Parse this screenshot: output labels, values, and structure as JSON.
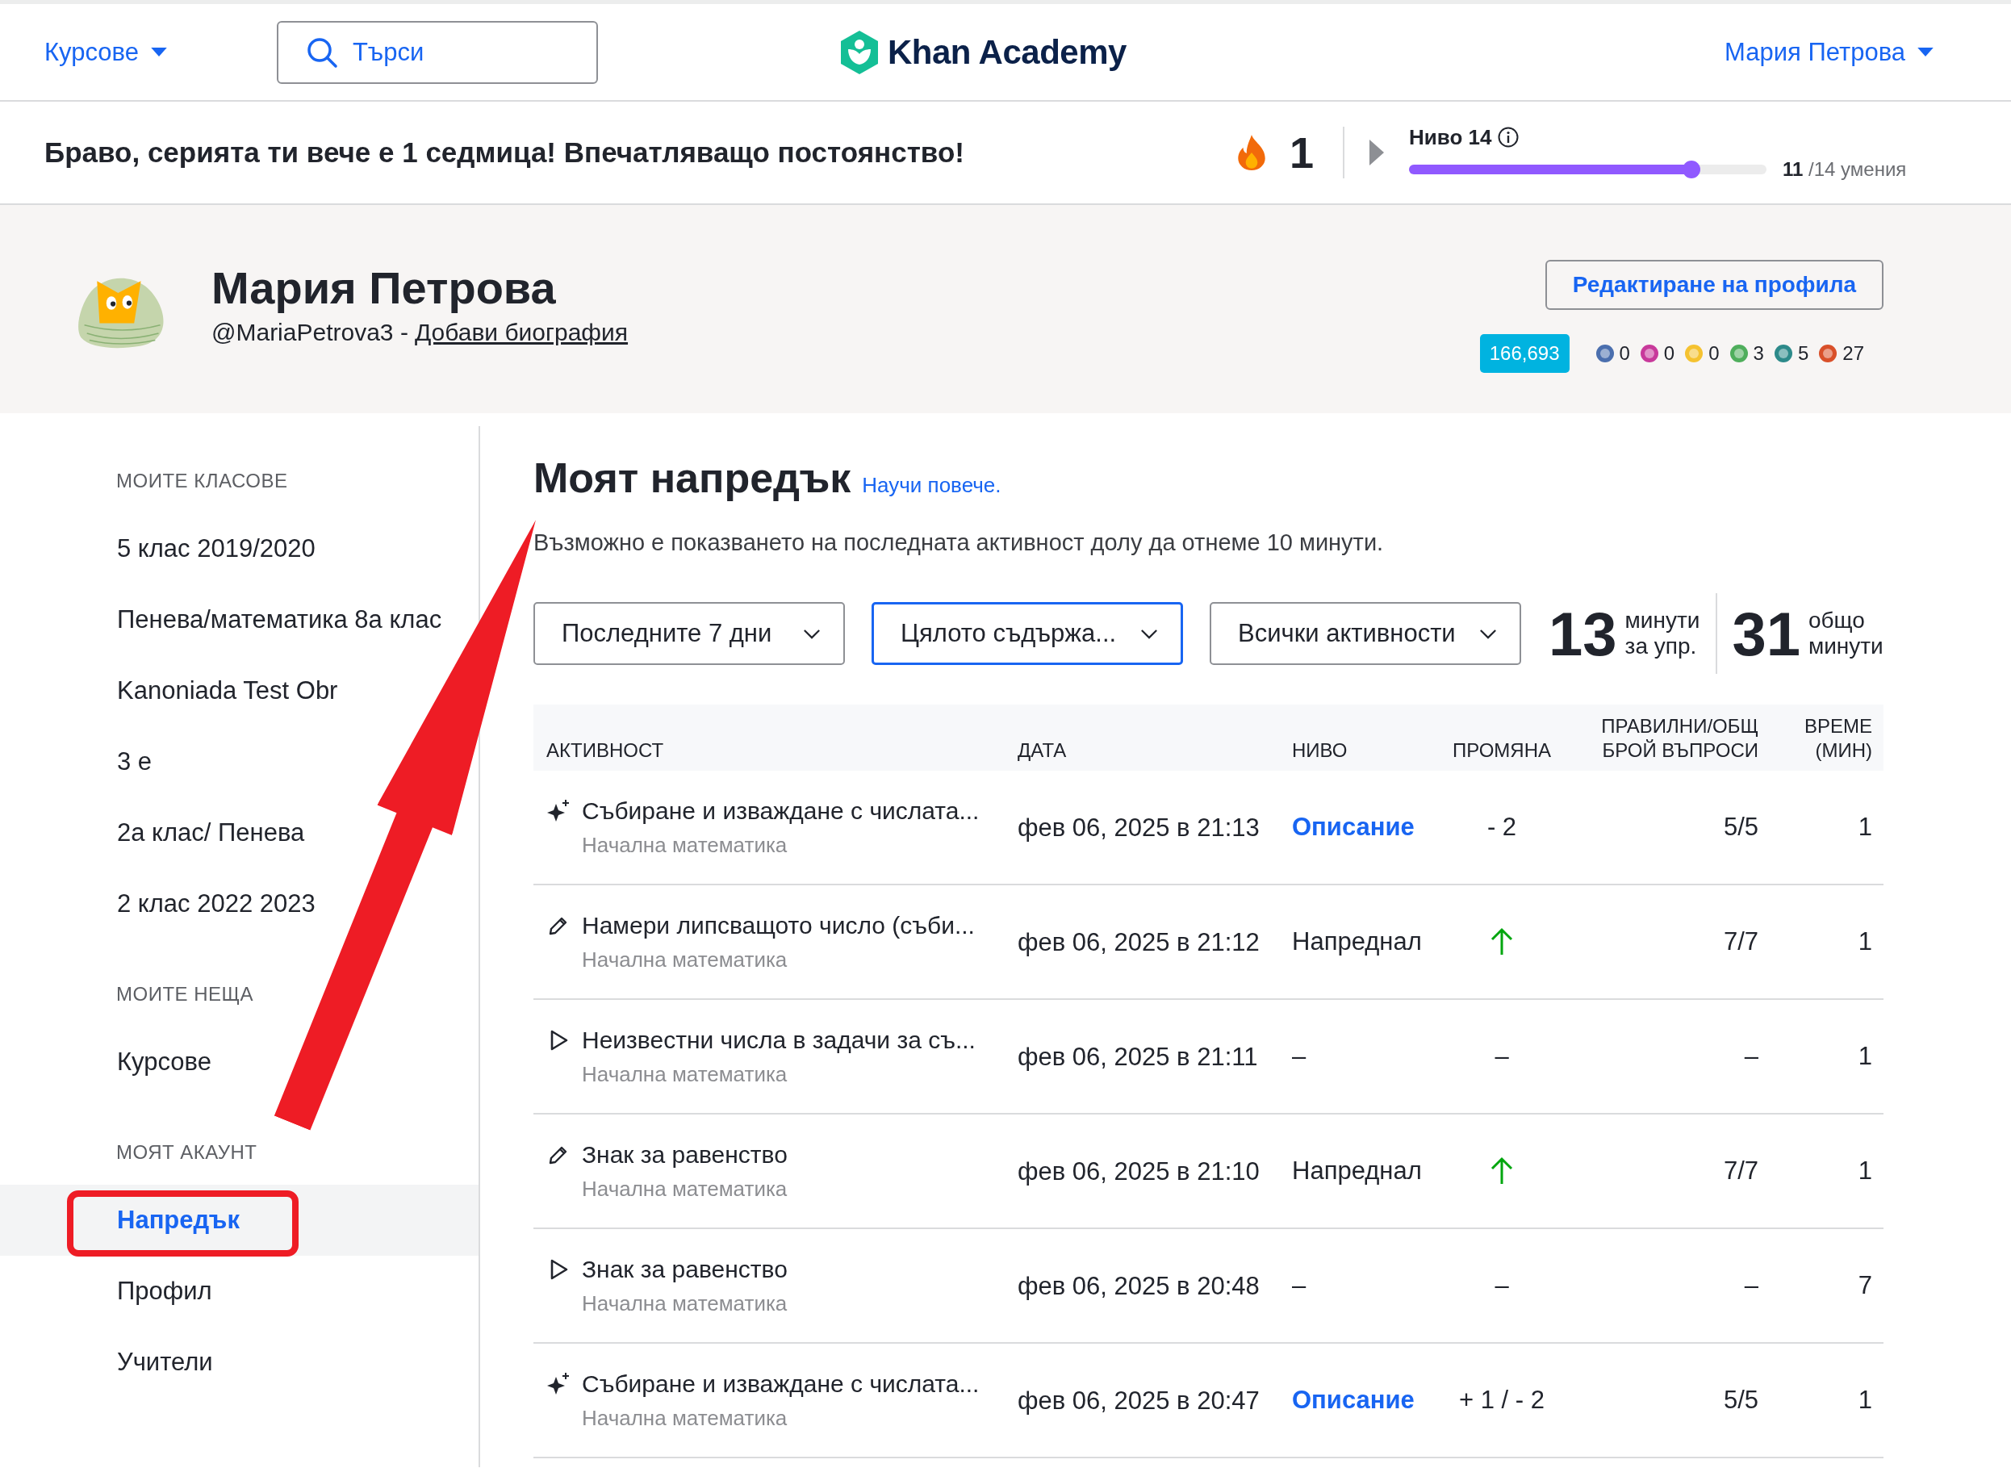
{
  "top_nav": {
    "courses_menu": "Курсове",
    "search": {
      "placeholder": "Търси"
    },
    "logo": "Khan Academy",
    "user_menu": "Мария Петрова"
  },
  "streak_bar": {
    "message": "Браво, серията ти вече е 1 седмица! Впечатляващо постоянство!",
    "streak_count": "1",
    "level_label": "Ниво 14",
    "level": 0.79,
    "skills_done": "11",
    "skills_total": "/14 умения"
  },
  "profile": {
    "name": "Мария Петрова",
    "handle": "@MariaPetrova3 -",
    "bio_link": "Добави биография",
    "edit_button": "Редактиране на профила",
    "points": "166,693",
    "badges": [
      {
        "color": "#4b6fae",
        "count": "0"
      },
      {
        "color": "#c8399b",
        "count": "0"
      },
      {
        "color": "#f5c230",
        "count": "0"
      },
      {
        "color": "#4fae5c",
        "count": "3"
      },
      {
        "color": "#2d8a8a",
        "count": "5"
      },
      {
        "color": "#d9502a",
        "count": "27"
      }
    ]
  },
  "sidebar": {
    "sections": [
      {
        "heading": "МОИТЕ КЛАСОВЕ",
        "items": [
          {
            "label": "5 клас 2019/2020",
            "selected": false
          },
          {
            "label": "Пенева/математика 8а клас",
            "selected": false
          },
          {
            "label": "Kanoniada Test Obr",
            "selected": false
          },
          {
            "label": "3 е",
            "selected": false
          },
          {
            "label": "2а клас/ Пенева",
            "selected": false
          },
          {
            "label": "2 клас 2022 2023",
            "selected": false
          }
        ]
      },
      {
        "heading": "МОИТЕ НЕЩА",
        "items": [
          {
            "label": "Курсове",
            "selected": false
          }
        ]
      },
      {
        "heading": "МОЯТ АКАУНТ",
        "items": [
          {
            "label": "Напредък",
            "selected": true
          },
          {
            "label": "Профил",
            "selected": false
          },
          {
            "label": "Учители",
            "selected": false
          }
        ]
      }
    ]
  },
  "progress": {
    "title": "Моят напредък",
    "learn_more": "Научи повече.",
    "notice": "Възможно е показването на последната активност долу да отнеме 10 минути.",
    "filters": [
      {
        "label": "Последните 7 дни",
        "focused": false
      },
      {
        "label": "Цялото съдържа...",
        "focused": true
      },
      {
        "label": "Всички активности",
        "focused": false
      }
    ],
    "stats": [
      {
        "value": "13",
        "lines": [
          "минути",
          "за упр."
        ]
      },
      {
        "value": "31",
        "lines": [
          "общо",
          "минути"
        ]
      }
    ],
    "table": {
      "columns": [
        {
          "lines": [
            "АКТИВНОСТ"
          ]
        },
        {
          "lines": [
            "ДАТА"
          ]
        },
        {
          "lines": [
            "НИВО"
          ]
        },
        {
          "lines": [
            "ПРОМЯНА"
          ]
        },
        {
          "lines": [
            "ПРАВИЛНИ/ОБЩ",
            "БРОЙ ВЪПРОСИ"
          ]
        },
        {
          "lines": [
            "ВРЕМЕ",
            "(МИН)"
          ]
        }
      ],
      "rows": [
        {
          "kind": "challenge",
          "title": "Събиране и изваждане с числата...",
          "course": "Начална математика",
          "date": "фев 06, 2025 в 21:13",
          "level": "Описание",
          "level_is_link": true,
          "change_up": false,
          "change": "- 2",
          "correct": "5/5",
          "time": "1"
        },
        {
          "kind": "exercise",
          "title": "Намери липсващото число (съби...",
          "course": "Начална математика",
          "date": "фев 06, 2025 в 21:12",
          "level": "Напреднал",
          "level_is_link": false,
          "change_up": true,
          "correct": "7/7",
          "time": "1"
        },
        {
          "kind": "video",
          "title": "Неизвестни числа в задачи за съ...",
          "course": "Начална математика",
          "date": "фев 06, 2025 в 21:11",
          "level": "–",
          "level_is_link": false,
          "change_up": false,
          "change": "–",
          "correct": "–",
          "time": "1"
        },
        {
          "kind": "exercise",
          "title": "Знак за равенство",
          "course": "Начална математика",
          "date": "фев 06, 2025 в 21:10",
          "level": "Напреднал",
          "level_is_link": false,
          "change_up": true,
          "correct": "7/7",
          "time": "1"
        },
        {
          "kind": "video",
          "title": "Знак за равенство",
          "course": "Начална математика",
          "date": "фев 06, 2025 в 20:48",
          "level": "–",
          "level_is_link": false,
          "change_up": false,
          "change": "–",
          "correct": "–",
          "time": "7"
        },
        {
          "kind": "challenge",
          "title": "Събиране и изваждане с числата...",
          "course": "Начална математика",
          "date": "фев 06, 2025 в 20:47",
          "level": "Описание",
          "level_is_link": true,
          "change_up": false,
          "change": "+ 1 / - 2",
          "correct": "5/5",
          "time": "1"
        }
      ]
    }
  }
}
